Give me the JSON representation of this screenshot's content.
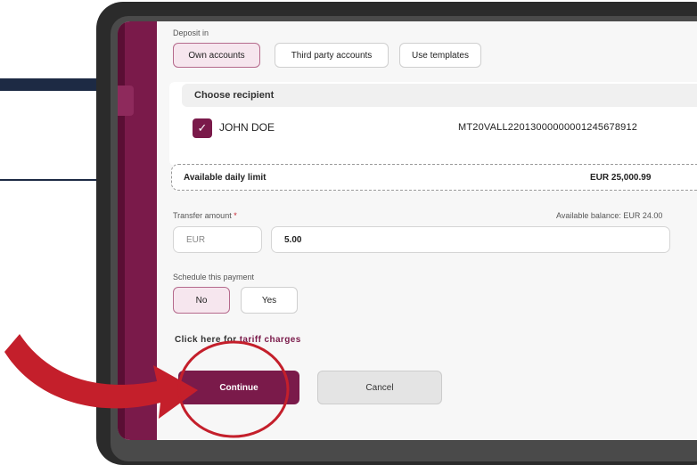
{
  "deposit": {
    "label": "Deposit in",
    "tabs": [
      {
        "label": "Own accounts",
        "active": true
      },
      {
        "label": "Third party accounts",
        "active": false
      },
      {
        "label": "Use templates",
        "active": false
      }
    ]
  },
  "recipient": {
    "header": "Choose recipient",
    "name": "JOHN DOE",
    "iban": "MT20VALL22013000000001245678912",
    "checked": true
  },
  "limit": {
    "label": "Available daily limit",
    "value": "EUR 25,000.99"
  },
  "transfer": {
    "label": "Transfer amount",
    "required_mark": "*",
    "balance": "Available balance: EUR 24.00",
    "currency": "EUR",
    "amount": "5.00"
  },
  "schedule": {
    "label": "Schedule this payment",
    "options": [
      {
        "label": "No",
        "active": true
      },
      {
        "label": "Yes",
        "active": false
      }
    ]
  },
  "tariff": {
    "prefix": "Click here for ",
    "link": "tariff charges"
  },
  "actions": {
    "continue_label": "Continue",
    "cancel_label": "Cancel"
  },
  "colors": {
    "brand": "#7a1a4a",
    "annotation": "#c41f2b",
    "background_lines": "#1d2a44"
  }
}
